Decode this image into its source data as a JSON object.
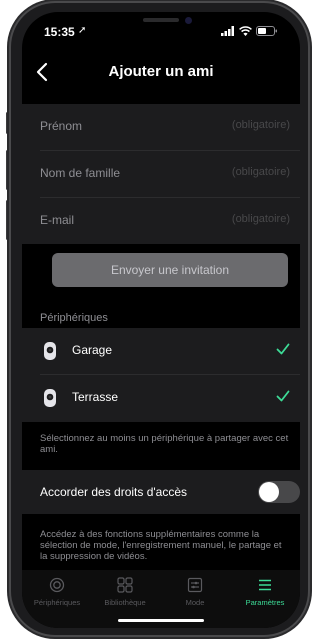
{
  "status": {
    "time": "15:35"
  },
  "nav": {
    "title": "Ajouter un ami"
  },
  "form": {
    "fields": [
      {
        "label": "Prénom",
        "hint": "(obligatoire)"
      },
      {
        "label": "Nom de famille",
        "hint": "(obligatoire)"
      },
      {
        "label": "E-mail",
        "hint": "(obligatoire)"
      }
    ],
    "invite_label": "Envoyer une invitation"
  },
  "devices": {
    "header": "Périphériques",
    "items": [
      {
        "name": "Garage",
        "selected": true
      },
      {
        "name": "Terrasse",
        "selected": true
      }
    ],
    "note": "Sélectionnez au moins un périphérique à partager avec cet ami."
  },
  "access": {
    "label": "Accorder des droits d'accès",
    "enabled": false,
    "note": "Accédez à des fonctions supplémentaires comme la sélection de mode, l'enregistrement manuel, le partage et la suppression de vidéos."
  },
  "tabbar": {
    "tabs": [
      {
        "label": "Périphériques",
        "icon": "camera-icon"
      },
      {
        "label": "Bibliothèque",
        "icon": "grid-icon"
      },
      {
        "label": "Mode",
        "icon": "sliders-icon"
      },
      {
        "label": "Paramètres",
        "icon": "menu-icon"
      }
    ],
    "active": "Paramètres"
  },
  "colors": {
    "accent": "#3ddc97",
    "background": "#000000",
    "surface": "#1c1c1e"
  }
}
